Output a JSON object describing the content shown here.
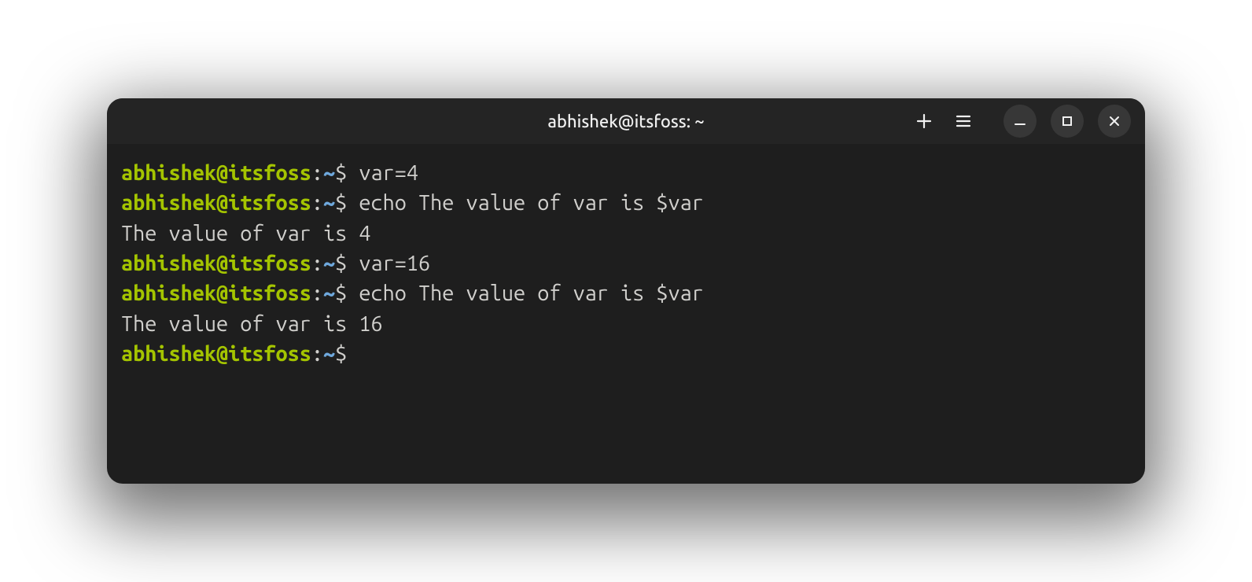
{
  "window": {
    "title": "abhishek@itsfoss: ~"
  },
  "prompt": {
    "user_host": "abhishek@itsfoss",
    "colon": ":",
    "path": "~",
    "dollar": "$"
  },
  "lines": [
    {
      "type": "cmd",
      "command": "var=4"
    },
    {
      "type": "cmd",
      "command": "echo The value of var is $var"
    },
    {
      "type": "output",
      "text": "The value of var is 4"
    },
    {
      "type": "cmd",
      "command": "var=16"
    },
    {
      "type": "cmd",
      "command": "echo The value of var is $var"
    },
    {
      "type": "output",
      "text": "The value of var is 16"
    },
    {
      "type": "cmd",
      "command": ""
    }
  ]
}
